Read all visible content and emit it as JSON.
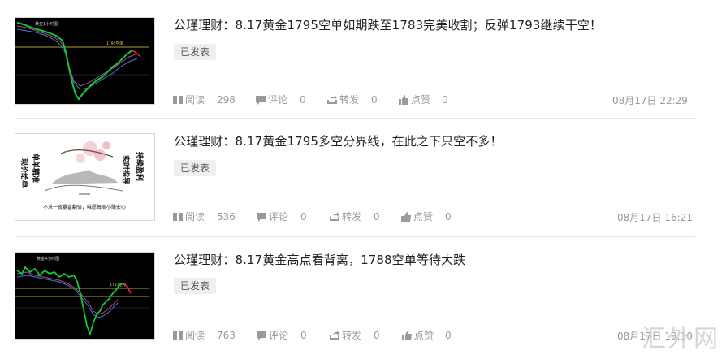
{
  "articles": [
    {
      "title": "公瑾理财：8.17黄金1795空单如期跌至1783完美收割；反弹1793继续干空！",
      "status": "已发表",
      "read_label": "阅读",
      "reads": "298",
      "comment_label": "评论",
      "comments": "0",
      "share_label": "转发",
      "shares": "0",
      "like_label": "点赞",
      "likes": "0",
      "date": "08月17日 22:29",
      "thumb": {
        "caption": "黄金1小时图",
        "mark": "1795空单"
      }
    },
    {
      "title": "公瑾理财：8.17黄金1795多空分界线，在此之下只空不多！",
      "status": "已发表",
      "read_label": "阅读",
      "reads": "536",
      "comment_label": "评论",
      "comments": "0",
      "share_label": "转发",
      "shares": "0",
      "like_label": "点赞",
      "likes": "0",
      "date": "08月17日 16:21",
      "thumb": {
        "left_lines": [
          "现价给单",
          "单单精准"
        ],
        "right_lines": [
          "实时指导",
          "持续盈利"
        ],
        "footer": "不求一夜暴富翻倍，唯愿每周小赚安心"
      }
    },
    {
      "title": "公瑾理财：8.17黄金高点看背离，1788空单等待大跌",
      "status": "已发表",
      "read_label": "阅读",
      "reads": "763",
      "comment_label": "评论",
      "comments": "0",
      "share_label": "转发",
      "shares": "0",
      "like_label": "点赞",
      "likes": "0",
      "date": "08月17日 13:10",
      "thumb": {
        "caption": "黄金4小时图",
        "mark": "1787空单"
      }
    }
  ],
  "watermark": "汇外网",
  "colors": {
    "divider": "#e5e5e5",
    "status_bg": "#efefef",
    "chart_bg": "#000000"
  }
}
